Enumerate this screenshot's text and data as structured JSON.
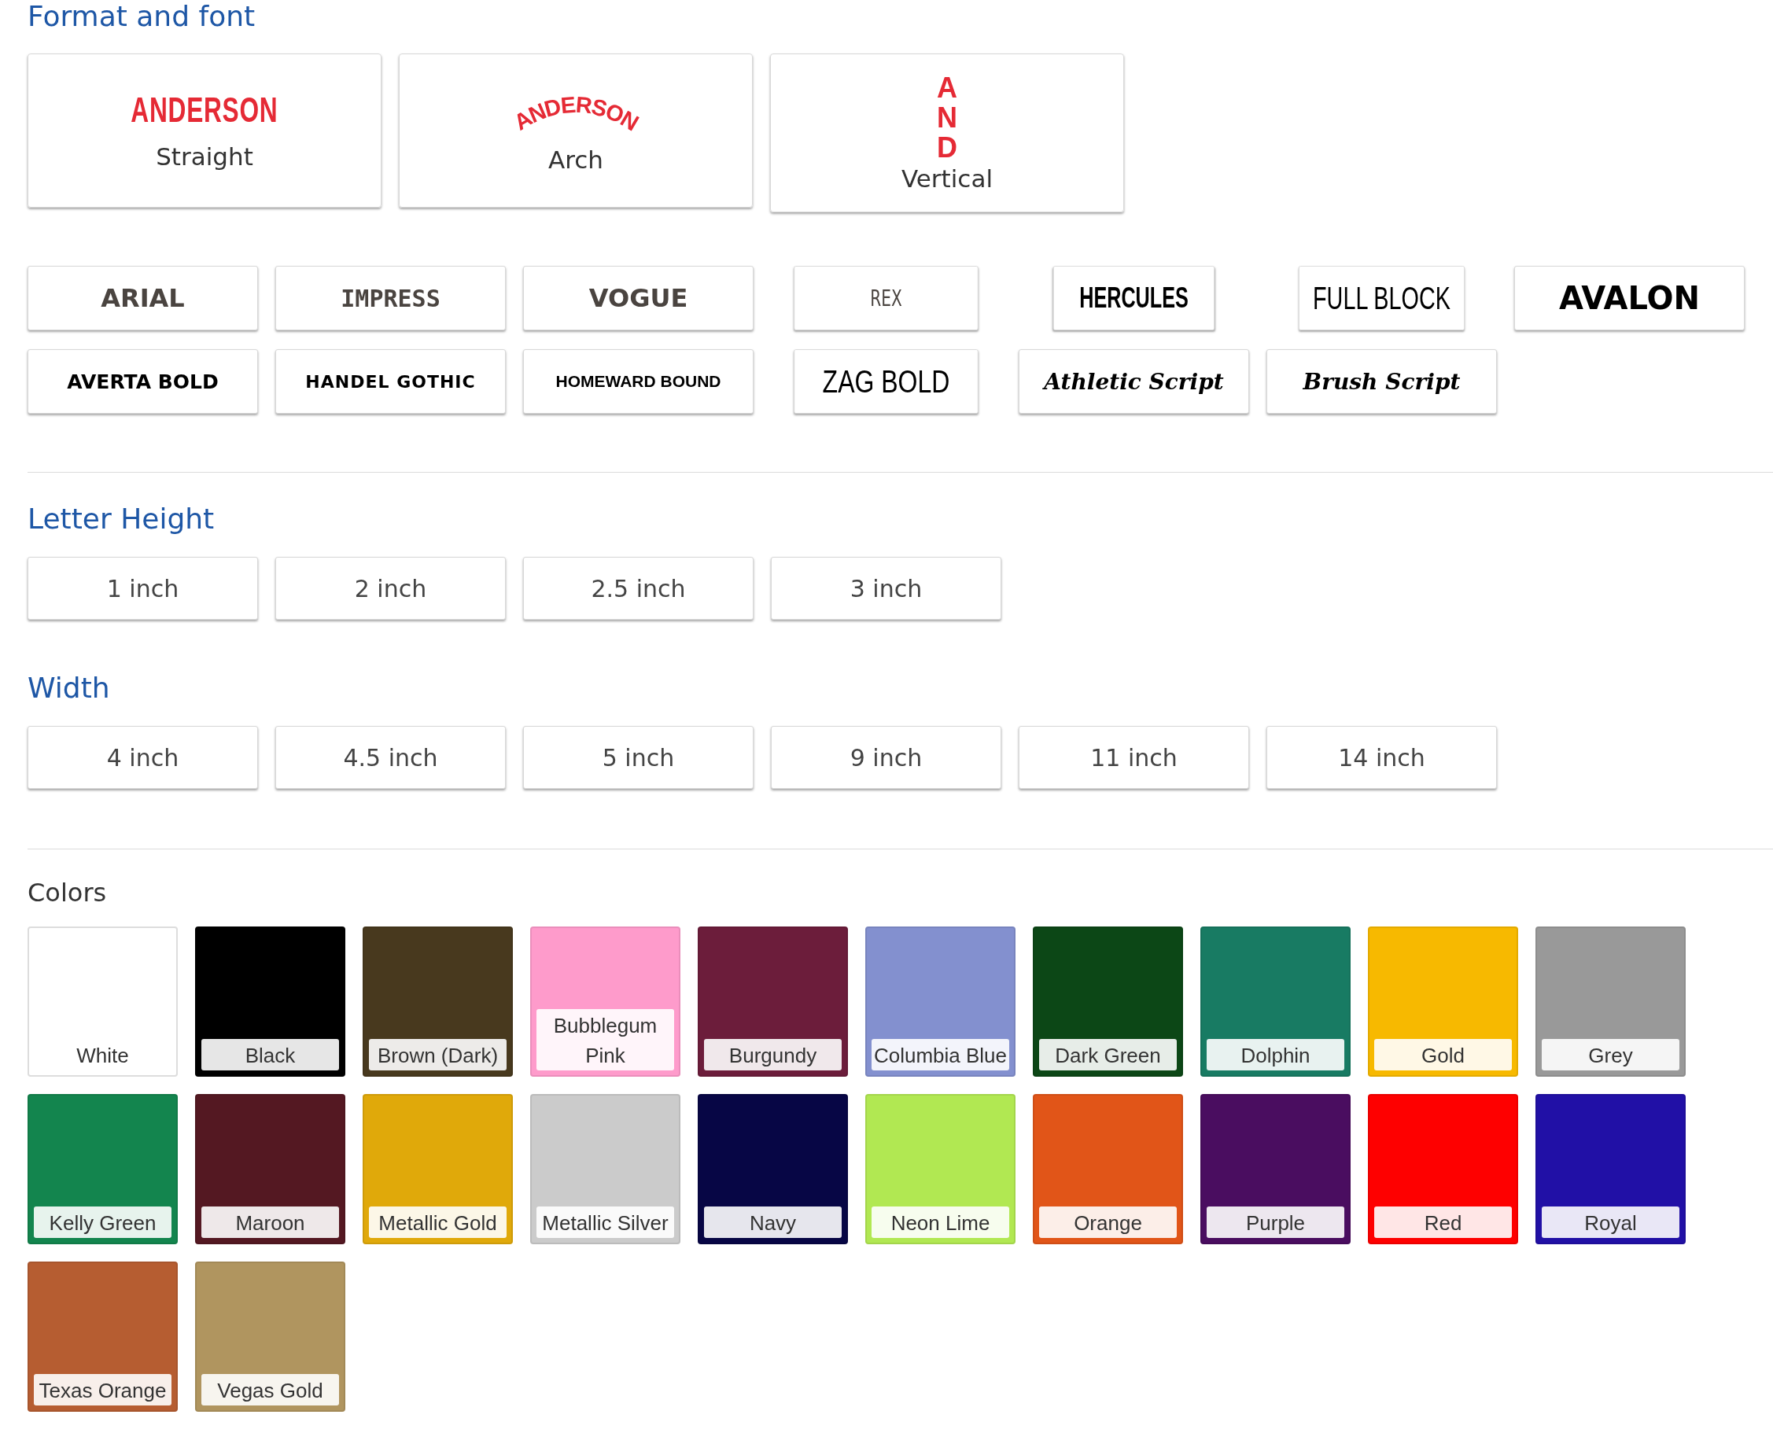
{
  "format_section": {
    "title": "Format and font",
    "formats": [
      {
        "kind": "straight",
        "sample": "ANDERSON",
        "label": "Straight"
      },
      {
        "kind": "arch",
        "sample": "ANDERSON",
        "label": "Arch"
      },
      {
        "kind": "vertical",
        "sample": "AND",
        "label": "Vertical"
      }
    ],
    "fonts": [
      "ARIAL",
      "IMPRESS",
      "VOGUE",
      "REX",
      "HERCULES",
      "FULL BLOCK",
      "AVALON",
      "AVERTA BOLD",
      "HANDEL GOTHIC",
      "HOMEWARD BOUND",
      "ZAG BOLD",
      "Athletic Script",
      "Brush Script"
    ]
  },
  "letter_height": {
    "title": "Letter Height",
    "options": [
      "1 inch",
      "2 inch",
      "2.5 inch",
      "3 inch"
    ]
  },
  "width": {
    "title": "Width",
    "options": [
      "4 inch",
      "4.5 inch",
      "5 inch",
      "9 inch",
      "11 inch",
      "14 inch"
    ]
  },
  "colors": {
    "title": "Colors",
    "swatches": [
      {
        "name": "White",
        "color": "#ffffff"
      },
      {
        "name": "Black",
        "color": "#000000"
      },
      {
        "name": "Brown (Dark)",
        "color": "#48391e"
      },
      {
        "name": "Bubblegum Pink",
        "color": "#fe9bcb"
      },
      {
        "name": "Burgundy",
        "color": "#6c1d3b"
      },
      {
        "name": "Columbia Blue",
        "color": "#8390cf"
      },
      {
        "name": "Dark Green",
        "color": "#0c4716"
      },
      {
        "name": "Dolphin",
        "color": "#187b63"
      },
      {
        "name": "Gold",
        "color": "#f7b900"
      },
      {
        "name": "Grey",
        "color": "#999999"
      },
      {
        "name": "Kelly Green",
        "color": "#13854e"
      },
      {
        "name": "Maroon",
        "color": "#541822"
      },
      {
        "name": "Metallic Gold",
        "color": "#e0a90a"
      },
      {
        "name": "Metallic Silver",
        "color": "#cbcbcb"
      },
      {
        "name": "Navy",
        "color": "#070645"
      },
      {
        "name": "Neon Lime",
        "color": "#b1e852"
      },
      {
        "name": "Orange",
        "color": "#e15518"
      },
      {
        "name": "Purple",
        "color": "#4a0d60"
      },
      {
        "name": "Red",
        "color": "#fe0000"
      },
      {
        "name": "Royal",
        "color": "#2110a6"
      },
      {
        "name": "Texas Orange",
        "color": "#b65d31"
      },
      {
        "name": "Vegas Gold",
        "color": "#b0955f"
      }
    ]
  }
}
